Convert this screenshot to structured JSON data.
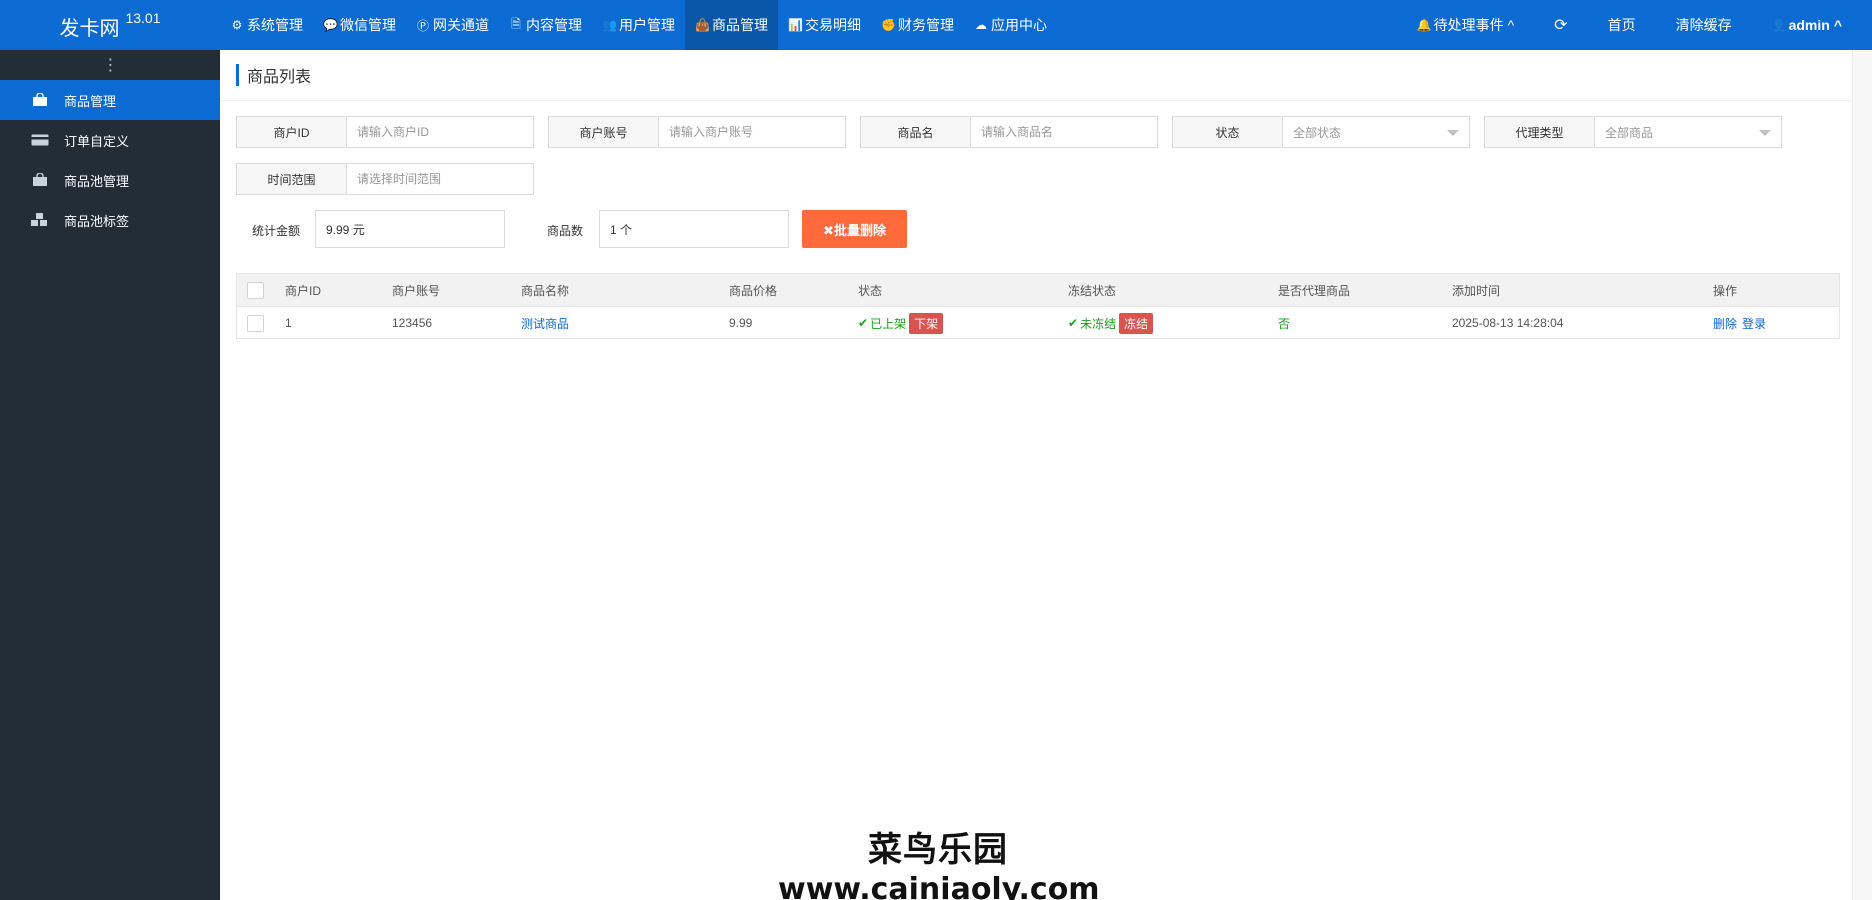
{
  "app": {
    "name": "发卡网",
    "version": "13.01"
  },
  "nav": [
    {
      "label": "系统管理",
      "icon": "gear-icon"
    },
    {
      "label": "微信管理",
      "icon": "wechat-icon"
    },
    {
      "label": "网关通道",
      "icon": "gateway-icon"
    },
    {
      "label": "内容管理",
      "icon": "file-icon"
    },
    {
      "label": "用户管理",
      "icon": "users-icon"
    },
    {
      "label": "商品管理",
      "icon": "bag-icon",
      "active": true
    },
    {
      "label": "交易明细",
      "icon": "bar-chart-icon"
    },
    {
      "label": "财务管理",
      "icon": "finance-icon"
    },
    {
      "label": "应用中心",
      "icon": "cloud-icon"
    }
  ],
  "right_nav": {
    "pending": "待处理事件",
    "refresh_icon": "refresh-icon",
    "home": "首页",
    "clear_cache": "清除缓存",
    "user": "admin"
  },
  "sidebar": {
    "items": [
      {
        "label": "商品管理",
        "icon": "bag-icon",
        "active": true
      },
      {
        "label": "订单自定义",
        "icon": "card-icon"
      },
      {
        "label": "商品池管理",
        "icon": "bag-icon"
      },
      {
        "label": "商品池标签",
        "icon": "cubes-icon"
      }
    ]
  },
  "page": {
    "title": "商品列表"
  },
  "filters": {
    "merchant_id": {
      "label": "商户ID",
      "placeholder": "请输入商户ID"
    },
    "merchant_account": {
      "label": "商户账号",
      "placeholder": "请输入商户账号"
    },
    "product_name": {
      "label": "商品名",
      "placeholder": "请输入商品名"
    },
    "status": {
      "label": "状态",
      "value": "全部状态"
    },
    "agent_type": {
      "label": "代理类型",
      "value": "全部商品"
    },
    "time_range": {
      "label": "时间范围",
      "placeholder": "请选择时间范围"
    }
  },
  "stats": {
    "amount_label": "统计金额",
    "amount_value": "9.99 元",
    "count_label": "商品数",
    "count_value": "1 个",
    "batch_delete": "✖批量删除"
  },
  "table": {
    "headers": [
      "商户ID",
      "商户账号",
      "商品名称",
      "商品价格",
      "状态",
      "冻结状态",
      "是否代理商品",
      "添加时间",
      "操作"
    ],
    "rows": [
      {
        "merchant_id": "1",
        "merchant_account": "123456",
        "product_name": "测试商品",
        "price": "9.99",
        "status": "已上架",
        "status_action": "下架",
        "freeze_status": "未冻结",
        "freeze_action": "冻结",
        "is_agent": "否",
        "added_at": "2025-08-13 14:28:04",
        "action_delete": "删除",
        "action_login": "登录"
      }
    ]
  },
  "watermark": {
    "line1": "菜鸟乐园",
    "line2": "www.cainiaoly.com"
  }
}
